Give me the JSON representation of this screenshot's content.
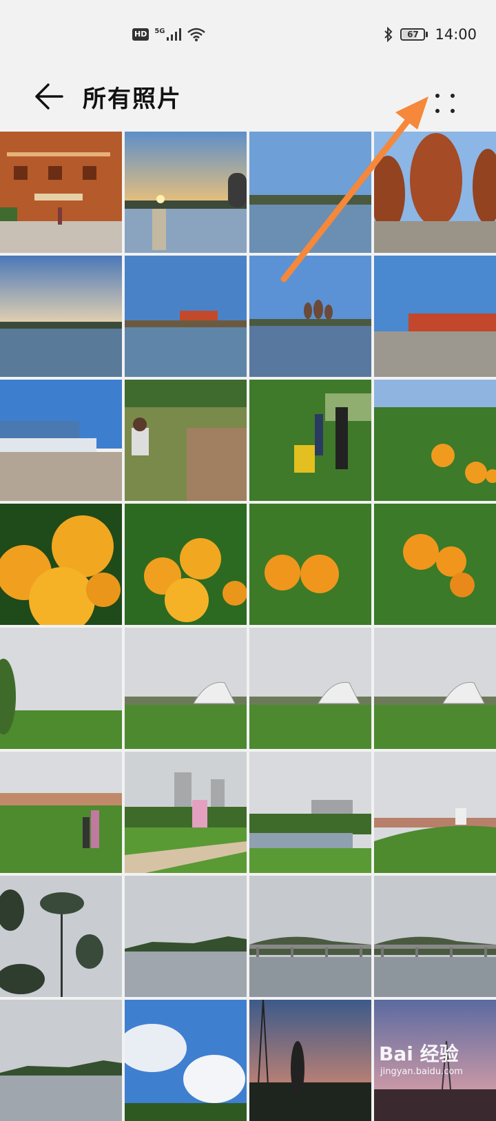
{
  "status_bar": {
    "hd": "HD",
    "network": "5G",
    "battery": "67",
    "time": "14:00"
  },
  "header": {
    "title": "所有照片"
  },
  "grid": {
    "photos": [
      {
        "scene": "wooden-building"
      },
      {
        "scene": "sunset-lake"
      },
      {
        "scene": "lake-shore"
      },
      {
        "scene": "egg-buildings"
      },
      {
        "scene": "lake-dusk"
      },
      {
        "scene": "lake-building"
      },
      {
        "scene": "lake-towers"
      },
      {
        "scene": "plaza-building"
      },
      {
        "scene": "blue-building"
      },
      {
        "scene": "child-field"
      },
      {
        "scene": "orchard-people"
      },
      {
        "scene": "orange-branch"
      },
      {
        "scene": "oranges-close"
      },
      {
        "scene": "oranges-cluster"
      },
      {
        "scene": "oranges-two"
      },
      {
        "scene": "oranges-three"
      },
      {
        "scene": "grass-tree"
      },
      {
        "scene": "grass-sculpture"
      },
      {
        "scene": "grass-sculpture"
      },
      {
        "scene": "grass-sculpture"
      },
      {
        "scene": "grass-couple"
      },
      {
        "scene": "park-path"
      },
      {
        "scene": "pond-towers"
      },
      {
        "scene": "grass-hill"
      },
      {
        "scene": "cloudy-trees"
      },
      {
        "scene": "cloudy-lake"
      },
      {
        "scene": "lake-bridge"
      },
      {
        "scene": "lake-bridge"
      },
      {
        "scene": "cloudy-lake"
      },
      {
        "scene": "blue-clouds"
      },
      {
        "scene": "sunset-tower"
      },
      {
        "scene": "sunset-pink"
      }
    ]
  },
  "watermark": {
    "main": "Bai 经验",
    "sub": "jingyan.baidu.com"
  },
  "colors": {
    "accent_arrow": "#f5883a"
  }
}
